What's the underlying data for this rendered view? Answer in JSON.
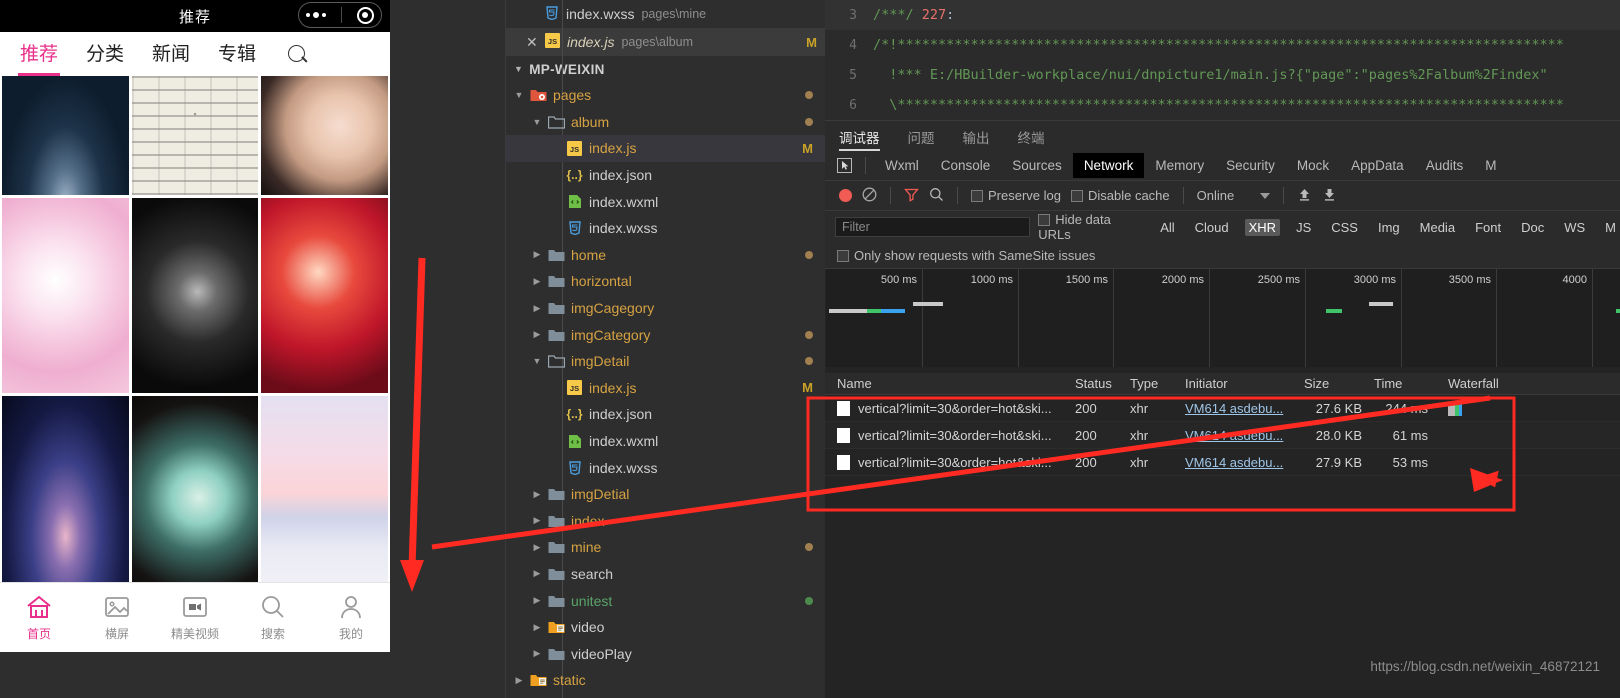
{
  "phone": {
    "status_title": "推荐",
    "capsule": {
      "more_icon": "more-dots-icon",
      "target_icon": "target-circle-icon"
    },
    "nav": [
      {
        "label": "推荐",
        "active": true
      },
      {
        "label": "分类",
        "active": false
      },
      {
        "label": "新闻",
        "active": false
      },
      {
        "label": "专辑",
        "active": false
      }
    ],
    "search_icon": "search-icon",
    "gallery": [
      {
        "name": "mountain-photo",
        "art": "art-mountain"
      },
      {
        "name": "meme-text-photo",
        "art": "art-meme"
      },
      {
        "name": "shoulder-portrait-photo",
        "art": "art-shoulder"
      },
      {
        "name": "pink-portrait-photo",
        "art": "art-pink"
      },
      {
        "name": "joker-photo",
        "art": "art-joker"
      },
      {
        "name": "red-hanfu-photo",
        "art": "art-red"
      },
      {
        "name": "avengers-photo",
        "art": "art-avengers"
      },
      {
        "name": "green-dress-photo",
        "art": "art-dress"
      },
      {
        "name": "pastel-sky-photo",
        "art": "art-sky"
      }
    ],
    "tabbar": [
      {
        "label": "首页",
        "icon": "home-icon",
        "active": true
      },
      {
        "label": "横屏",
        "icon": "image-icon",
        "active": false
      },
      {
        "label": "精美视频",
        "icon": "video-icon",
        "active": false
      },
      {
        "label": "搜索",
        "icon": "search-icon",
        "active": false
      },
      {
        "label": "我的",
        "icon": "user-icon",
        "active": false
      }
    ]
  },
  "explorer": {
    "open_tabs": [
      {
        "icon": "wxss-file-icon",
        "name": "index.wxss",
        "path": "pages\\mine",
        "modified": "",
        "selected": false,
        "closable": false
      },
      {
        "icon": "js-file-icon",
        "name": "index.js",
        "path": "pages\\album",
        "modified": "M",
        "selected": true,
        "closable": true
      }
    ],
    "section_title": "MP-WEIXIN",
    "tree": [
      {
        "indent": 1,
        "twisty": "down",
        "icon": "folder-open-red-icon",
        "label": "pages",
        "style": "folder",
        "dot": "#a08050"
      },
      {
        "indent": 2,
        "twisty": "down",
        "icon": "folder-open-icon",
        "label": "album",
        "style": "folder",
        "dot": "#a08050"
      },
      {
        "indent": 3,
        "twisty": "none",
        "icon": "js-file-icon",
        "label": "index.js",
        "style": "folder",
        "mod": "M",
        "selected": true
      },
      {
        "indent": 3,
        "twisty": "none",
        "icon": "json-file-icon",
        "label": "index.json",
        "style": "file"
      },
      {
        "indent": 3,
        "twisty": "none",
        "icon": "wxml-file-icon",
        "label": "index.wxml",
        "style": "file"
      },
      {
        "indent": 3,
        "twisty": "none",
        "icon": "wxss-file-icon",
        "label": "index.wxss",
        "style": "file"
      },
      {
        "indent": 2,
        "twisty": "right",
        "icon": "folder-icon",
        "label": "home",
        "style": "folder",
        "dot": "#a08050"
      },
      {
        "indent": 2,
        "twisty": "right",
        "icon": "folder-icon",
        "label": "horizontal",
        "style": "folder"
      },
      {
        "indent": 2,
        "twisty": "right",
        "icon": "folder-icon",
        "label": "imgCagegory",
        "style": "folder"
      },
      {
        "indent": 2,
        "twisty": "right",
        "icon": "folder-icon",
        "label": "imgCategory",
        "style": "folder",
        "dot": "#a08050"
      },
      {
        "indent": 2,
        "twisty": "down",
        "icon": "folder-open-icon",
        "label": "imgDetail",
        "style": "folder",
        "dot": "#a08050"
      },
      {
        "indent": 3,
        "twisty": "none",
        "icon": "js-file-icon",
        "label": "index.js",
        "style": "folder",
        "mod": "M"
      },
      {
        "indent": 3,
        "twisty": "none",
        "icon": "json-file-icon",
        "label": "index.json",
        "style": "file"
      },
      {
        "indent": 3,
        "twisty": "none",
        "icon": "wxml-file-icon",
        "label": "index.wxml",
        "style": "file"
      },
      {
        "indent": 3,
        "twisty": "none",
        "icon": "wxss-file-icon",
        "label": "index.wxss",
        "style": "file"
      },
      {
        "indent": 2,
        "twisty": "right",
        "icon": "folder-icon",
        "label": "imgDetial",
        "style": "folder"
      },
      {
        "indent": 2,
        "twisty": "right",
        "icon": "folder-icon",
        "label": "index",
        "style": "folder"
      },
      {
        "indent": 2,
        "twisty": "right",
        "icon": "folder-icon",
        "label": "mine",
        "style": "folder",
        "dot": "#a08050"
      },
      {
        "indent": 2,
        "twisty": "right",
        "icon": "folder-icon",
        "label": "search",
        "style": "white"
      },
      {
        "indent": 2,
        "twisty": "right",
        "icon": "folder-icon",
        "label": "unitest",
        "style": "green",
        "dot": "#4d8a4d"
      },
      {
        "indent": 2,
        "twisty": "right",
        "icon": "folder-orange-icon",
        "label": "video",
        "style": "white"
      },
      {
        "indent": 2,
        "twisty": "right",
        "icon": "folder-icon",
        "label": "videoPlay",
        "style": "white"
      },
      {
        "indent": 1,
        "twisty": "right",
        "icon": "folder-orange-icon",
        "label": "static",
        "style": "folder"
      }
    ]
  },
  "editor": {
    "lines": [
      {
        "no": "3",
        "highlight": true,
        "segments": [
          {
            "t": "/***/ ",
            "c": "cm"
          },
          {
            "t": "227",
            "c": "num"
          },
          {
            "t": ":",
            "c": "pn"
          }
        ]
      },
      {
        "no": "4",
        "highlight": false,
        "segments": [
          {
            "t": "/*!**********************************************************************************",
            "c": "cm"
          }
        ]
      },
      {
        "no": "5",
        "highlight": false,
        "segments": [
          {
            "t": "  !*** E:/HBuilder-workplace/nui/dnpicture1/main.js?{\"page\":\"pages%2Falbum%2Findex\"",
            "c": "cm"
          }
        ]
      },
      {
        "no": "6",
        "highlight": false,
        "segments": [
          {
            "t": "  \\**********************************************************************************",
            "c": "cm"
          }
        ]
      }
    ]
  },
  "devtools": {
    "panel_tabs": [
      {
        "label": "调试器",
        "active": true
      },
      {
        "label": "问题",
        "active": false
      },
      {
        "label": "输出",
        "active": false
      },
      {
        "label": "终端",
        "active": false
      }
    ],
    "tool_tabs": [
      {
        "label": "Wxml",
        "active": false
      },
      {
        "label": "Console",
        "active": false
      },
      {
        "label": "Sources",
        "active": false
      },
      {
        "label": "Network",
        "active": true
      },
      {
        "label": "Memory",
        "active": false
      },
      {
        "label": "Security",
        "active": false
      },
      {
        "label": "Mock",
        "active": false
      },
      {
        "label": "AppData",
        "active": false
      },
      {
        "label": "Audits",
        "active": false
      },
      {
        "label": "M",
        "active": false
      }
    ],
    "inspect_icon": "inspect-cursor-icon",
    "controls": {
      "record_icon": "record-button-icon",
      "clear_icon": "clear-icon",
      "filter_icon": "filter-funnel-icon",
      "search_icon": "search-icon",
      "preserve_log": "Preserve log",
      "disable_cache": "Disable cache",
      "throttling": "Online",
      "upload_icon": "upload-arrow-icon",
      "download_icon": "download-arrow-icon"
    },
    "filter": {
      "placeholder": "Filter",
      "value": "",
      "hide_data_urls": "Hide data URLs",
      "types": [
        {
          "label": "All",
          "active": false
        },
        {
          "label": "Cloud",
          "active": false
        },
        {
          "label": "XHR",
          "active": true
        },
        {
          "label": "JS",
          "active": false
        },
        {
          "label": "CSS",
          "active": false
        },
        {
          "label": "Img",
          "active": false
        },
        {
          "label": "Media",
          "active": false
        },
        {
          "label": "Font",
          "active": false
        },
        {
          "label": "Doc",
          "active": false
        },
        {
          "label": "WS",
          "active": false
        },
        {
          "label": "M",
          "active": false
        }
      ],
      "samesite": "Only show requests with SameSite issues"
    },
    "timeline": {
      "ticks": [
        "500 ms",
        "1000 ms",
        "1500 ms",
        "2000 ms",
        "2500 ms",
        "3000 ms",
        "3500 ms",
        "4000"
      ]
    },
    "table": {
      "columns": [
        "Name",
        "Status",
        "Type",
        "Initiator",
        "Size",
        "Time",
        "Waterfall"
      ],
      "rows": [
        {
          "name": "vertical?limit=30&order=hot&ski...",
          "status": "200",
          "type": "xhr",
          "initiator": "VM614 asdebu...",
          "size": "27.6 KB",
          "time": "244 ms"
        },
        {
          "name": "vertical?limit=30&order=hot&ski...",
          "status": "200",
          "type": "xhr",
          "initiator": "VM614 asdebu...",
          "size": "28.0 KB",
          "time": "61 ms"
        },
        {
          "name": "vertical?limit=30&order=hot&ski...",
          "status": "200",
          "type": "xhr",
          "initiator": "VM614 asdebu...",
          "size": "27.9 KB",
          "time": "53 ms"
        }
      ]
    }
  },
  "watermark": "https://blog.csdn.net/weixin_46872121",
  "annotations": {
    "accent_color": "#ff2a21",
    "down_arrow": "down-arrow-annotation",
    "diagonal_arrow": "diagonal-arrow-annotation",
    "highlight_box": "highlight-box-annotation"
  }
}
